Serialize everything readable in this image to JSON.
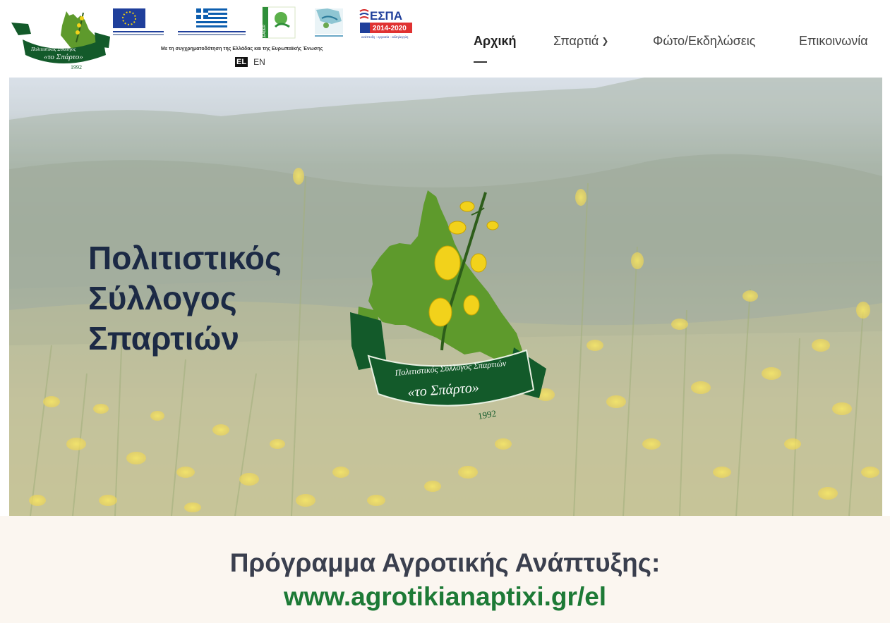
{
  "header": {
    "logo_small": {
      "org_text": "Πολιτιστικός Σύλλογος",
      "name": "«το Σπάρτο»",
      "year": "1992"
    },
    "partners": {
      "espa_label": "ΕΣΠΑ",
      "espa_years": "2014-2020",
      "espa_sub": "ανάπτυξη - εργασία - αλληλεγγύη",
      "leader_label": "LEADER"
    },
    "funding_text": "Με τη συγχρηματοδότηση της Ελλάδας και της Ευρωπαϊκής Ένωσης",
    "languages": {
      "el": "EL",
      "en": "EN"
    }
  },
  "nav": {
    "items": [
      {
        "label": "Αρχική"
      },
      {
        "label": "Σπαρτιά"
      },
      {
        "label": "Φώτο/Εκδηλώσεις"
      },
      {
        "label": "Επικοινωνία"
      }
    ]
  },
  "hero": {
    "title_line1": "Πολιτιστικός",
    "title_line2": "Σύλλογος",
    "title_line3": "Σπαρτιών",
    "logo": {
      "org_text": "Πολιτιστικός Σύλλογος Σπαρτιών",
      "name": "«το Σπάρτο»",
      "year": "1992"
    }
  },
  "band": {
    "title": "Πρόγραμμα Αγροτικής Ανάπτυξης:",
    "link": "www.agrotikianaptixi.gr/el"
  },
  "colors": {
    "brand_green": "#1d7a36",
    "ribbon_green": "#135a2a",
    "map_green": "#5e9a2c",
    "flower_yellow": "#f2d21b",
    "title_navy": "#1c2a45"
  }
}
